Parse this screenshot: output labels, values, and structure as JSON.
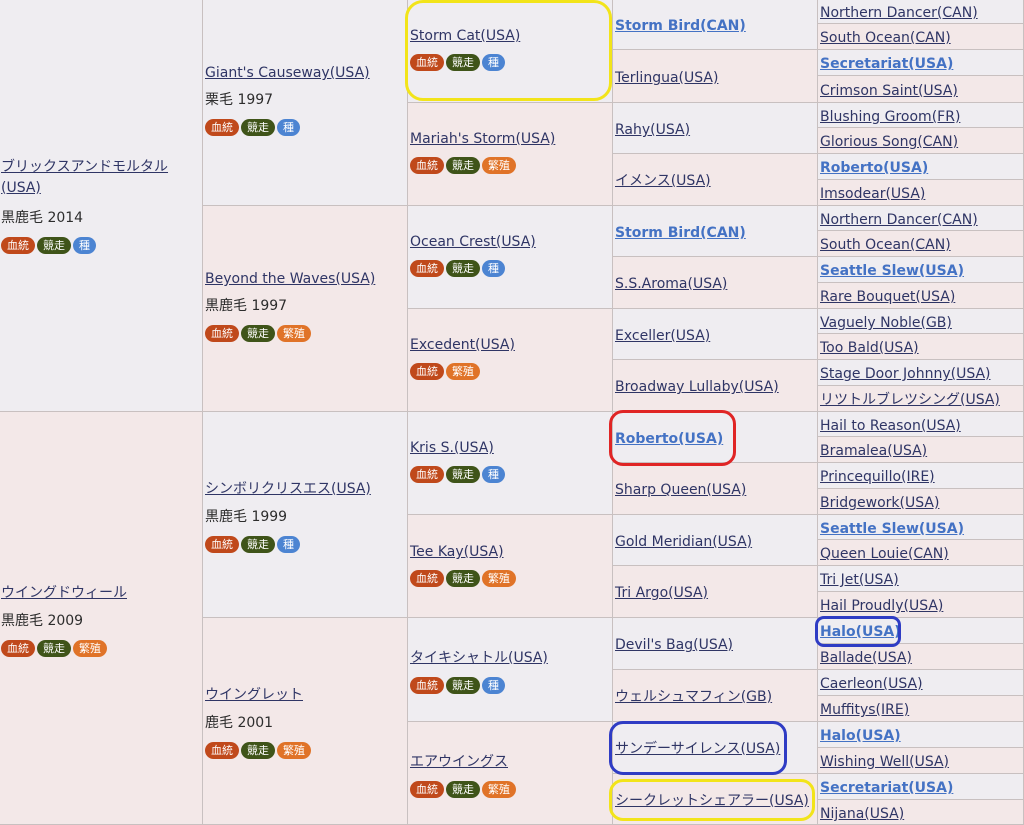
{
  "badge_labels": {
    "blood": "血統",
    "race": "競走",
    "stud": "種",
    "breed": "繁殖"
  },
  "gen1": [
    {
      "name": "ブリックスアンドモルタル(USA)",
      "info": "黒鹿毛 2014"
    },
    {
      "name": "ウイングドウィール",
      "info": "黒鹿毛 2009"
    }
  ],
  "gen2": [
    {
      "name": "Giant's Causeway(USA)",
      "info": "栗毛 1997"
    },
    {
      "name": "Beyond the Waves(USA)",
      "info": "黒鹿毛 1997"
    },
    {
      "name": "シンボリクリスエス(USA)",
      "info": "黒鹿毛 1999"
    },
    {
      "name": "ウイングレット",
      "info": "鹿毛 2001"
    }
  ],
  "gen3": [
    {
      "name": "Storm Cat(USA)"
    },
    {
      "name": "Mariah's Storm(USA)"
    },
    {
      "name": "Ocean Crest(USA)"
    },
    {
      "name": "Excedent(USA)"
    },
    {
      "name": "Kris S.(USA)"
    },
    {
      "name": "Tee Kay(USA)"
    },
    {
      "name": "タイキシャトル(USA)"
    },
    {
      "name": "エアウイングス"
    }
  ],
  "gen4": [
    {
      "name": "Storm Bird(CAN)"
    },
    {
      "name": "Terlingua(USA)"
    },
    {
      "name": "Rahy(USA)"
    },
    {
      "name": "イメンス(USA)"
    },
    {
      "name": "Storm Bird(CAN)"
    },
    {
      "name": "S.S.Aroma(USA)"
    },
    {
      "name": "Exceller(USA)"
    },
    {
      "name": "Broadway Lullaby(USA)"
    },
    {
      "name": "Roberto(USA)"
    },
    {
      "name": "Sharp Queen(USA)"
    },
    {
      "name": "Gold Meridian(USA)"
    },
    {
      "name": "Tri Argo(USA)"
    },
    {
      "name": "Devil's Bag(USA)"
    },
    {
      "name": "ウェルシュマフィン(GB)"
    },
    {
      "name": "サンデーサイレンス(USA)"
    },
    {
      "name": "シークレットシェアラー(USA)"
    }
  ],
  "gen5": [
    {
      "name": "Northern Dancer(CAN)"
    },
    {
      "name": "South Ocean(CAN)"
    },
    {
      "name": "Secretariat(USA)"
    },
    {
      "name": "Crimson Saint(USA)"
    },
    {
      "name": "Blushing Groom(FR)"
    },
    {
      "name": "Glorious Song(CAN)"
    },
    {
      "name": "Roberto(USA)"
    },
    {
      "name": "Imsodear(USA)"
    },
    {
      "name": "Northern Dancer(CAN)"
    },
    {
      "name": "South Ocean(CAN)"
    },
    {
      "name": "Seattle Slew(USA)"
    },
    {
      "name": "Rare Bouquet(USA)"
    },
    {
      "name": "Vaguely Noble(GB)"
    },
    {
      "name": "Too Bald(USA)"
    },
    {
      "name": "Stage Door Johnny(USA)"
    },
    {
      "name": "リツトルブレツシング(USA)"
    },
    {
      "name": "Hail to Reason(USA)"
    },
    {
      "name": "Bramalea(USA)"
    },
    {
      "name": "Princequillo(IRE)"
    },
    {
      "name": "Bridgework(USA)"
    },
    {
      "name": "Seattle Slew(USA)"
    },
    {
      "name": "Queen Louie(CAN)"
    },
    {
      "name": "Tri Jet(USA)"
    },
    {
      "name": "Hail Proudly(USA)"
    },
    {
      "name": "Halo(USA)"
    },
    {
      "name": "Ballade(USA)"
    },
    {
      "name": "Caerleon(USA)"
    },
    {
      "name": "Muffitys(IRE)"
    },
    {
      "name": "Halo(USA)"
    },
    {
      "name": "Wishing Well(USA)"
    },
    {
      "name": "Secretariat(USA)"
    },
    {
      "name": "Nijana(USA)"
    }
  ]
}
